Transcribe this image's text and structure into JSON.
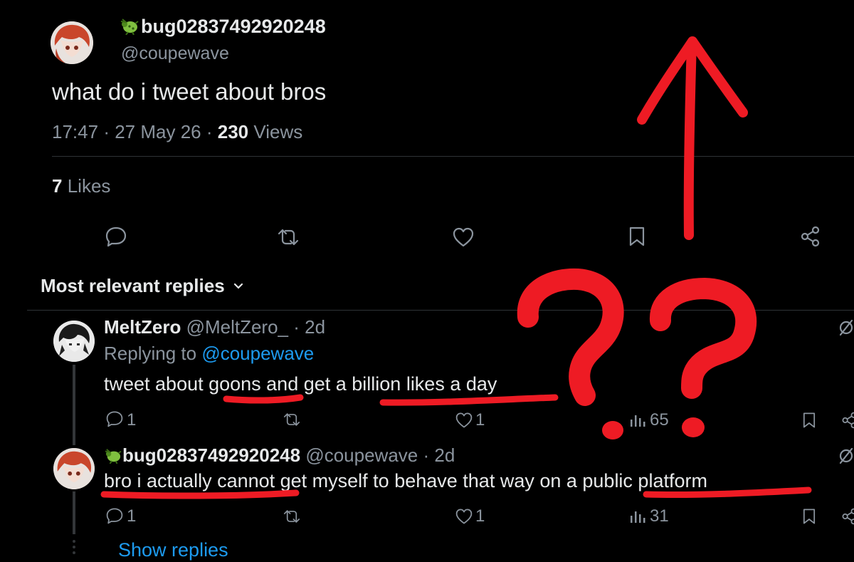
{
  "tweet": {
    "display_name": "bug02837492920248",
    "handle": "@coupewave",
    "text": "what do i tweet about bros",
    "time": "17:47",
    "sep1": "·",
    "date": "27 May 26",
    "sep2": "·",
    "views_count": "230",
    "views_label": "Views",
    "likes_count": "7",
    "likes_label": "Likes"
  },
  "replies_header": {
    "label": "Most relevant replies",
    "icon": "chevron-down-icon"
  },
  "replies": [
    {
      "display_name": "MeltZero",
      "handle": "@MeltZero_",
      "time": "· 2d",
      "replying_prefix": "Replying to",
      "replying_to": "@coupewave",
      "text": "tweet about goons and get a billion likes a day",
      "reply_count": "1",
      "like_count": "1",
      "views": "65"
    },
    {
      "display_name": "bug02837492920248",
      "handle": "@coupewave",
      "time": "· 2d",
      "text": "bro i actually cannot get myself to behave that way on a public platform",
      "reply_count": "1",
      "like_count": "1",
      "views": "31"
    }
  ],
  "show_replies": "Show replies",
  "annotations": {
    "question_marks": "??",
    "color": "#ee1b24"
  },
  "colors": {
    "background": "#000000",
    "text": "#e7e9ea",
    "muted": "#8b949e",
    "link": "#1d9bf0",
    "annotation_red": "#ee1b24"
  }
}
